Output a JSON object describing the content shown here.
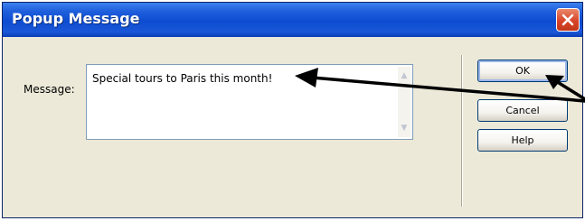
{
  "window": {
    "title": "Popup Message",
    "close_icon": "close-icon"
  },
  "form": {
    "message_label": "Message:",
    "message_value": "Special tours to Paris this month!"
  },
  "buttons": {
    "ok": "OK",
    "cancel": "Cancel",
    "help": "Help"
  },
  "colors": {
    "titlebar": "#0d4cd1",
    "close": "#d9442a",
    "dialog_bg": "#ece9d8"
  }
}
